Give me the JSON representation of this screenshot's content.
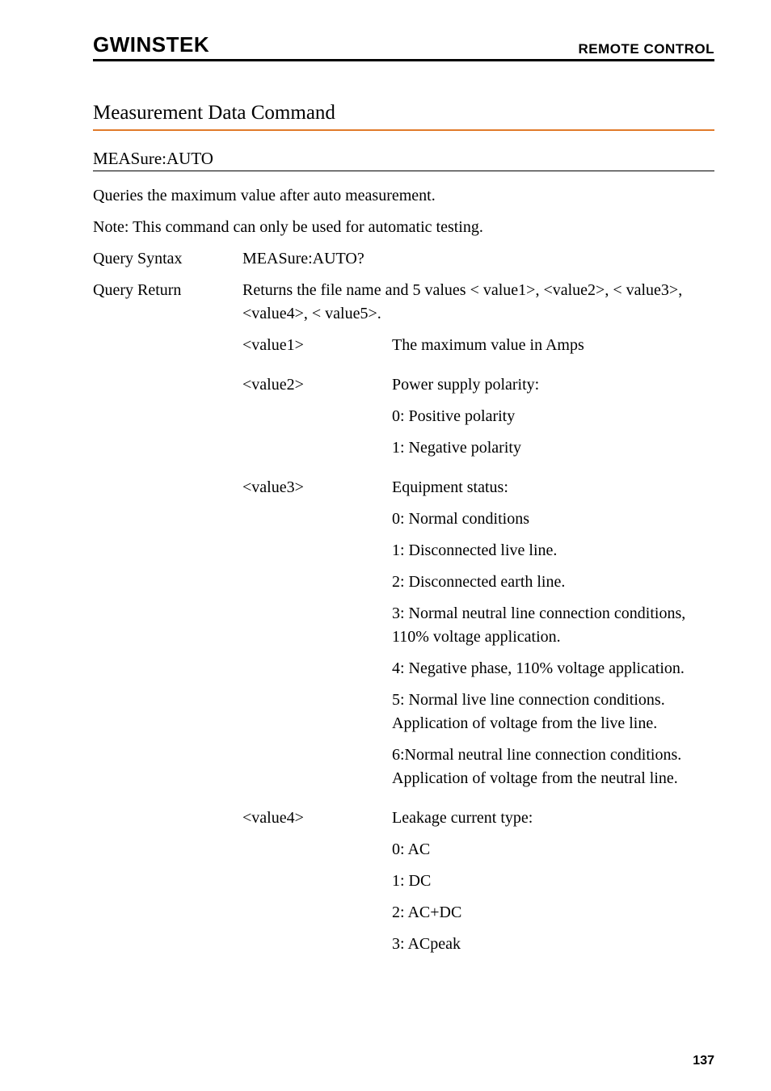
{
  "header": {
    "logo": "GWINSTEK",
    "title": "REMOTE CONTROL"
  },
  "section_title": "Measurement Data Command",
  "sub_title": "MEASure:AUTO",
  "intro1": "Queries the maximum value after auto measurement.",
  "intro2": "Note: This command can only be used for automatic testing.",
  "query_syntax_label": "Query Syntax",
  "query_syntax_value": "MEASure:AUTO?",
  "query_return_label": "Query Return",
  "query_return_desc": "Returns the file name and 5 values < value1>, <value2>, < value3>, <value4>, < value5>.",
  "value1_label": "<value1>",
  "value1_desc": "The maximum value in Amps",
  "value2_label": "<value2>",
  "value2_desc1": "Power supply polarity:",
  "value2_desc2": "0: Positive polarity",
  "value2_desc3": "1: Negative polarity",
  "value3_label": "<value3>",
  "value3_desc1": "Equipment status:",
  "value3_desc2": "0: Normal conditions",
  "value3_desc3": "1: Disconnected live line.",
  "value3_desc4": "2: Disconnected earth line.",
  "value3_desc5": "3: Normal neutral line connection conditions, 110% voltage application.",
  "value3_desc6": "4: Negative phase, 110% voltage application.",
  "value3_desc7": "5: Normal live line connection conditions. Application of voltage from the live line.",
  "value3_desc8": "6:Normal neutral line connection conditions. Application of voltage from the neutral line.",
  "value4_label": "<value4>",
  "value4_desc1": "Leakage current type:",
  "value4_desc2": "0: AC",
  "value4_desc3": "1: DC",
  "value4_desc4": "2: AC+DC",
  "value4_desc5": "3: ACpeak",
  "page_number": "137"
}
